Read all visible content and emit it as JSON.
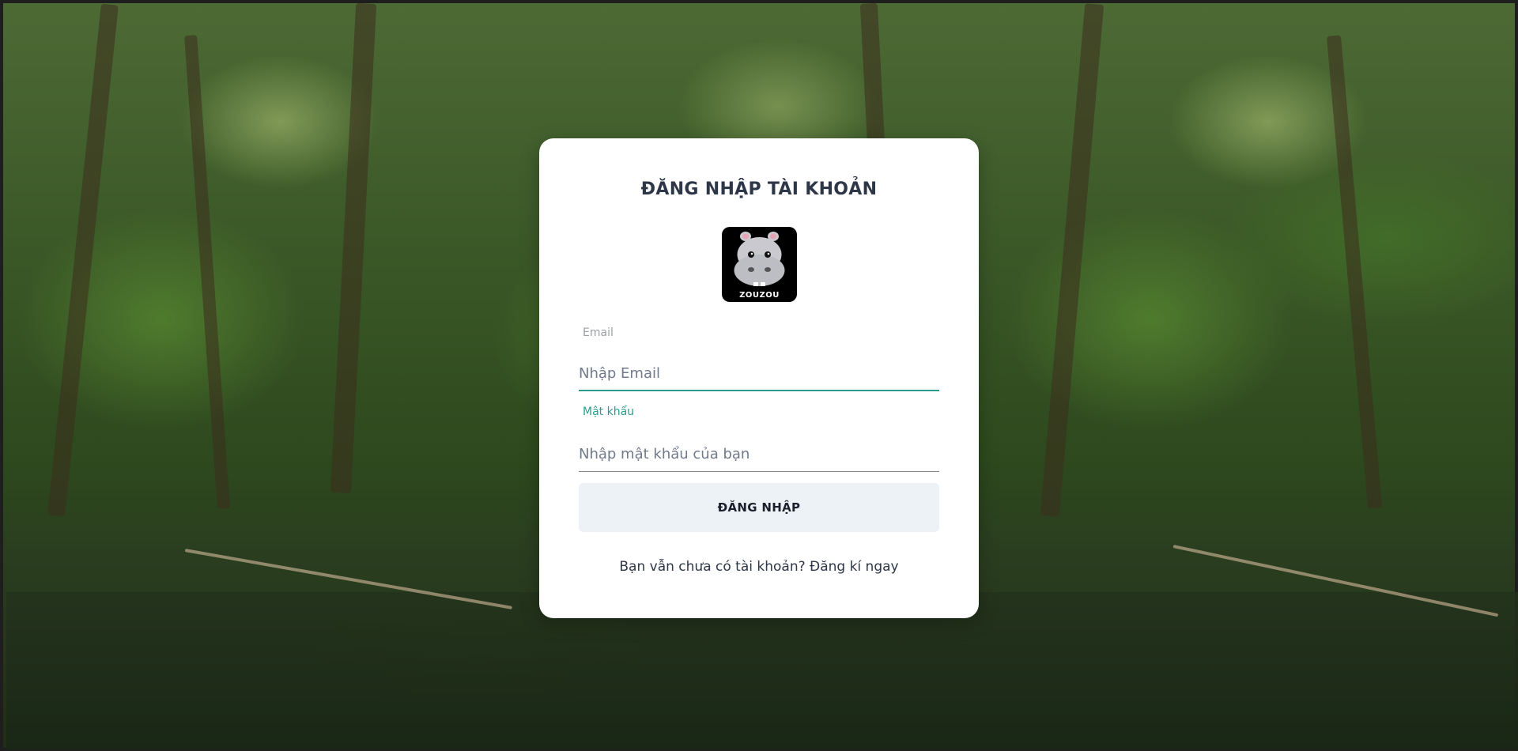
{
  "page": {
    "background": "forest-background-image",
    "accent_color": "#2a9d8f"
  },
  "login": {
    "title": "ĐĂNG NHẬP TÀI KHOẢN",
    "logo": {
      "icon": "hippo-logo",
      "text": "ZOUZOU"
    },
    "email": {
      "label": "Email",
      "placeholder": "Nhập Email",
      "value": ""
    },
    "password": {
      "label": "Mật khẩu",
      "placeholder": "Nhập mật khẩu của bạn",
      "value": ""
    },
    "submit_label": "ĐĂNG NHẬP",
    "signup_text": "Bạn vẫn chưa có tài khoản? Đăng kí ngay"
  }
}
